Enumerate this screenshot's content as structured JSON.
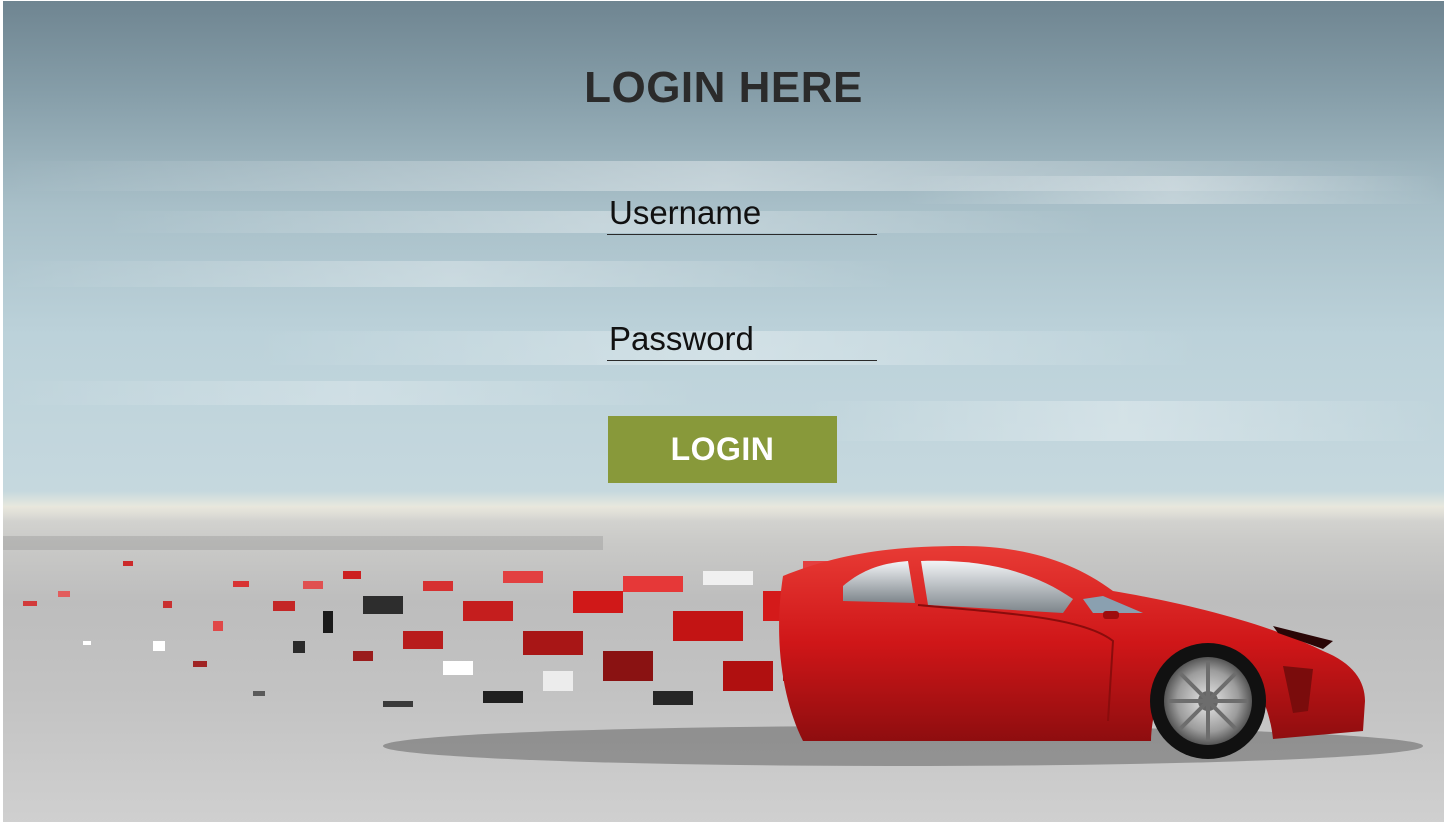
{
  "login": {
    "title": "LOGIN HERE",
    "username_placeholder": "Username",
    "password_placeholder": "Password",
    "button_label": "LOGIN"
  },
  "colors": {
    "button": "#88993a",
    "car": "#d4191c",
    "title": "#2b2b2b"
  }
}
